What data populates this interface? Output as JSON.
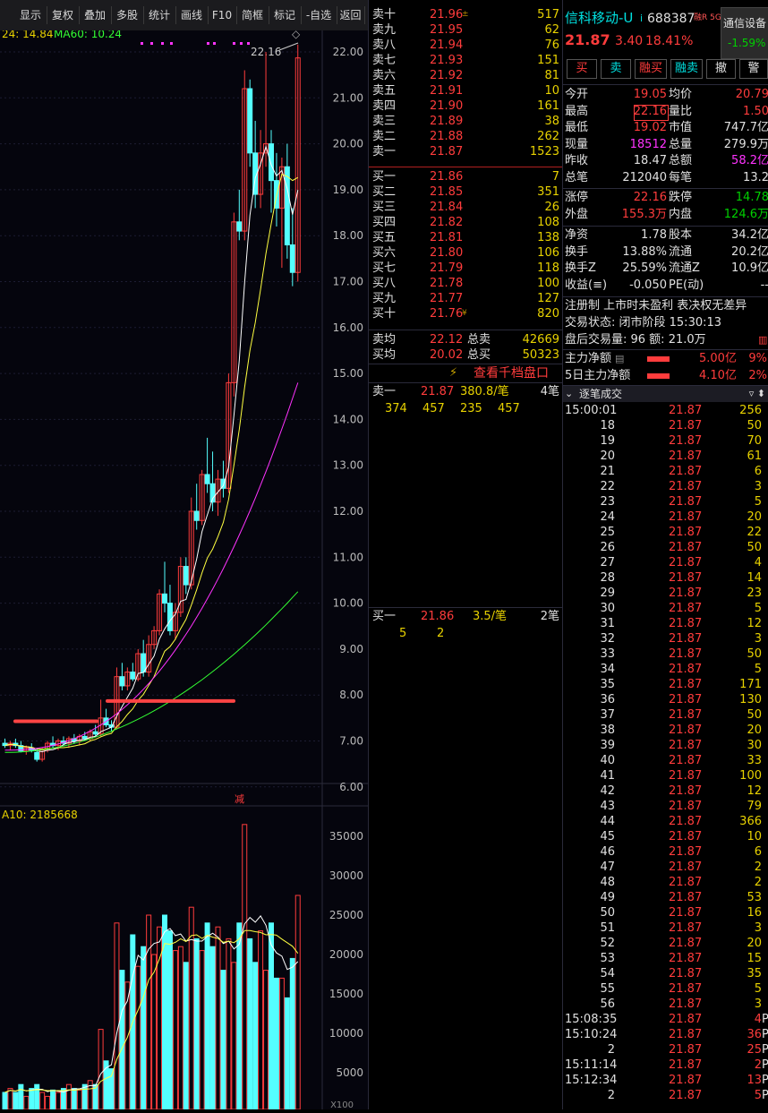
{
  "toolbar": {
    "items": [
      "显示",
      "复权",
      "叠加",
      "多股",
      "统计",
      "画线",
      "F10",
      "简框",
      "标记",
      "-自选",
      "返回"
    ]
  },
  "chart": {
    "ma_label_left": "24: 14.84",
    "ma60_label": "MA60: 10.24",
    "max_label": "22.16",
    "vol_label": "A10: 2185668",
    "tag_label": "减",
    "price_ticks": [
      "22.00",
      "21.00",
      "20.00",
      "19.00",
      "18.00",
      "17.00",
      "16.00",
      "15.00",
      "14.00",
      "13.00",
      "12.00",
      "11.00",
      "10.00",
      "9.00",
      "8.00",
      "7.00",
      "6.00"
    ],
    "vol_ticks": [
      "35000",
      "30000",
      "25000",
      "20000",
      "15000",
      "10000",
      "5000"
    ],
    "vol_unit": "X100",
    "colors": {
      "up": "#ff3c3c",
      "down": "#54ffff",
      "ma5": "#ffffff",
      "ma10": "#ffff40",
      "ma20": "#ff33ff",
      "ma60": "#33ff33",
      "mark": "#ff4444"
    }
  },
  "orderbook": {
    "asks": [
      {
        "label": "卖十",
        "price": "21.96",
        "vol": "517",
        "flag": "±"
      },
      {
        "label": "卖九",
        "price": "21.95",
        "vol": "62"
      },
      {
        "label": "卖八",
        "price": "21.94",
        "vol": "76"
      },
      {
        "label": "卖七",
        "price": "21.93",
        "vol": "151"
      },
      {
        "label": "卖六",
        "price": "21.92",
        "vol": "81"
      },
      {
        "label": "卖五",
        "price": "21.91",
        "vol": "10"
      },
      {
        "label": "卖四",
        "price": "21.90",
        "vol": "161"
      },
      {
        "label": "卖三",
        "price": "21.89",
        "vol": "38"
      },
      {
        "label": "卖二",
        "price": "21.88",
        "vol": "262"
      },
      {
        "label": "卖一",
        "price": "21.87",
        "vol": "1523"
      }
    ],
    "bids": [
      {
        "label": "买一",
        "price": "21.86",
        "vol": "7"
      },
      {
        "label": "买二",
        "price": "21.85",
        "vol": "351"
      },
      {
        "label": "买三",
        "price": "21.84",
        "vol": "26"
      },
      {
        "label": "买四",
        "price": "21.82",
        "vol": "108"
      },
      {
        "label": "买五",
        "price": "21.81",
        "vol": "138"
      },
      {
        "label": "买六",
        "price": "21.80",
        "vol": "106"
      },
      {
        "label": "买七",
        "price": "21.79",
        "vol": "118"
      },
      {
        "label": "买八",
        "price": "21.78",
        "vol": "100"
      },
      {
        "label": "买九",
        "price": "21.77",
        "vol": "127"
      },
      {
        "label": "买十",
        "price": "21.76",
        "vol": "820",
        "flag": "¥"
      }
    ],
    "avg_sell_label": "卖均",
    "avg_sell": "22.12",
    "total_sell_label": "总卖",
    "total_sell": "42669",
    "avg_buy_label": "买均",
    "avg_buy": "20.02",
    "total_buy_label": "总买",
    "total_buy": "50323",
    "thousand_link": "查看千档盘口",
    "sell1_detail": {
      "label": "卖一",
      "price": "21.87",
      "per": "380.8/笔",
      "count": "4笔",
      "orders": [
        "374",
        "457",
        "235",
        "457"
      ]
    },
    "buy1_detail": {
      "label": "买一",
      "price": "21.86",
      "per": "3.5/笔",
      "count": "2笔",
      "orders": [
        "5",
        "2"
      ]
    }
  },
  "quote": {
    "name": "信科移动-U",
    "info_glyph": "i",
    "code": "688387",
    "badge": "融R 5G",
    "price": "21.87",
    "change": "3.40",
    "pct": "18.41%",
    "sector_name": "通信设备",
    "sector_pct": "-1.59%",
    "buttons": [
      "买",
      "卖",
      "融买",
      "融卖",
      "撤",
      "警"
    ],
    "fields": [
      {
        "k1": "今开",
        "v1": "19.05",
        "c1": "r",
        "k2": "均价",
        "v2": "20.79",
        "c2": "r"
      },
      {
        "k1": "最高",
        "v1": "22.16",
        "c1": "r",
        "k2": "量比",
        "v2": "1.50",
        "c2": "r"
      },
      {
        "k1": "最低",
        "v1": "19.02",
        "c1": "r",
        "k2": "市值",
        "v2": "747.7亿",
        "c2": "w"
      },
      {
        "k1": "现量",
        "v1": "18512",
        "c1": "m",
        "k2": "总量",
        "v2": "279.9万",
        "c2": "w"
      },
      {
        "k1": "昨收",
        "v1": "18.47",
        "c1": "w",
        "k2": "总额",
        "v2": "58.2亿",
        "c2": "m"
      },
      {
        "k1": "总笔",
        "v1": "212040",
        "c1": "w",
        "k2": "每笔",
        "v2": "13.2",
        "c2": "w"
      }
    ],
    "fields2": [
      {
        "k1": "涨停",
        "v1": "22.16",
        "c1": "r",
        "k2": "跌停",
        "v2": "14.78",
        "c2": "g"
      },
      {
        "k1": "外盘",
        "v1": "155.3万",
        "c1": "r",
        "k2": "内盘",
        "v2": "124.6万",
        "c2": "g"
      }
    ],
    "fields3": [
      {
        "k1": "净资",
        "v1": "1.78",
        "c1": "w",
        "k2": "股本",
        "v2": "34.2亿",
        "c2": "w"
      },
      {
        "k1": "换手",
        "v1": "13.88%",
        "c1": "w",
        "k2": "流通",
        "v2": "20.2亿",
        "c2": "w"
      },
      {
        "k1": "换手Z",
        "v1": "25.59%",
        "c1": "w",
        "k2": "流通Z",
        "v2": "10.9亿",
        "c2": "w"
      },
      {
        "k1": "收益(≡)",
        "v1": "-0.050",
        "c1": "w",
        "k2": "PE(动)",
        "v2": "--",
        "c2": "w"
      }
    ],
    "reg_note": "注册制 上市时未盈利 表决权无差异",
    "trade_status": "交易状态: 闭市阶段 15:30:13",
    "after_hours": "盘后交易量: 96  额: 21.0万",
    "main_net_label": "主力净额",
    "main_net": "5.00亿",
    "main_net_pct": "9%",
    "main5_label": "5日主力净额",
    "main5": "4.10亿",
    "main5_pct": "2%",
    "ticks_title": "逐笔成交",
    "ticks": [
      {
        "t": "15:00:01",
        "p": "21.87",
        "v": "256"
      },
      {
        "t": "18",
        "p": "21.87",
        "v": "50"
      },
      {
        "t": "19",
        "p": "21.87",
        "v": "70"
      },
      {
        "t": "20",
        "p": "21.87",
        "v": "61"
      },
      {
        "t": "21",
        "p": "21.87",
        "v": "6"
      },
      {
        "t": "22",
        "p": "21.87",
        "v": "3"
      },
      {
        "t": "23",
        "p": "21.87",
        "v": "5"
      },
      {
        "t": "24",
        "p": "21.87",
        "v": "20"
      },
      {
        "t": "25",
        "p": "21.87",
        "v": "22"
      },
      {
        "t": "26",
        "p": "21.87",
        "v": "50"
      },
      {
        "t": "27",
        "p": "21.87",
        "v": "4"
      },
      {
        "t": "28",
        "p": "21.87",
        "v": "14"
      },
      {
        "t": "29",
        "p": "21.87",
        "v": "23"
      },
      {
        "t": "30",
        "p": "21.87",
        "v": "5"
      },
      {
        "t": "31",
        "p": "21.87",
        "v": "12"
      },
      {
        "t": "32",
        "p": "21.87",
        "v": "3"
      },
      {
        "t": "33",
        "p": "21.87",
        "v": "50"
      },
      {
        "t": "34",
        "p": "21.87",
        "v": "5"
      },
      {
        "t": "35",
        "p": "21.87",
        "v": "171"
      },
      {
        "t": "36",
        "p": "21.87",
        "v": "130"
      },
      {
        "t": "37",
        "p": "21.87",
        "v": "50"
      },
      {
        "t": "38",
        "p": "21.87",
        "v": "20"
      },
      {
        "t": "39",
        "p": "21.87",
        "v": "30"
      },
      {
        "t": "40",
        "p": "21.87",
        "v": "33"
      },
      {
        "t": "41",
        "p": "21.87",
        "v": "100"
      },
      {
        "t": "42",
        "p": "21.87",
        "v": "12"
      },
      {
        "t": "43",
        "p": "21.87",
        "v": "79"
      },
      {
        "t": "44",
        "p": "21.87",
        "v": "366"
      },
      {
        "t": "45",
        "p": "21.87",
        "v": "10"
      },
      {
        "t": "46",
        "p": "21.87",
        "v": "6"
      },
      {
        "t": "47",
        "p": "21.87",
        "v": "2"
      },
      {
        "t": "48",
        "p": "21.87",
        "v": "2"
      },
      {
        "t": "49",
        "p": "21.87",
        "v": "53"
      },
      {
        "t": "50",
        "p": "21.87",
        "v": "16"
      },
      {
        "t": "51",
        "p": "21.87",
        "v": "3"
      },
      {
        "t": "52",
        "p": "21.87",
        "v": "20"
      },
      {
        "t": "53",
        "p": "21.87",
        "v": "15"
      },
      {
        "t": "54",
        "p": "21.87",
        "v": "35"
      },
      {
        "t": "55",
        "p": "21.87",
        "v": "5"
      },
      {
        "t": "56",
        "p": "21.87",
        "v": "3"
      },
      {
        "t": "15:08:35",
        "p": "21.87",
        "v": "4",
        "s": "P"
      },
      {
        "t": "15:10:24",
        "p": "21.87",
        "v": "36",
        "s": "P"
      },
      {
        "t": "2",
        "p": "21.87",
        "v": "25",
        "s": "P"
      },
      {
        "t": "15:11:14",
        "p": "21.87",
        "v": "2",
        "s": "P"
      },
      {
        "t": "15:12:34",
        "p": "21.87",
        "v": "13",
        "s": "P"
      },
      {
        "t": "2",
        "p": "21.87",
        "v": "5",
        "s": "P"
      }
    ]
  }
}
